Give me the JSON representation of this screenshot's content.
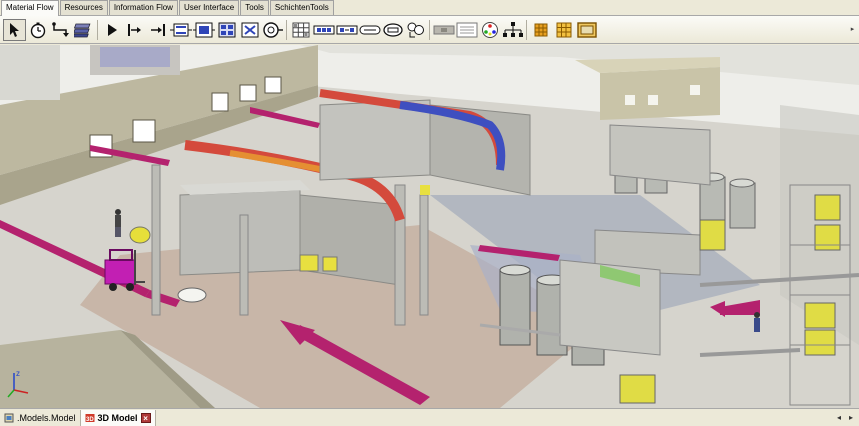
{
  "tabs": [
    {
      "label": "Material Flow",
      "active": true
    },
    {
      "label": "Resources",
      "active": false
    },
    {
      "label": "Information Flow",
      "active": false
    },
    {
      "label": "User Interface",
      "active": false
    },
    {
      "label": "Tools",
      "active": false
    },
    {
      "label": "SchichtenTools",
      "active": false
    }
  ],
  "toolbar": {
    "icons": [
      "pointer-icon",
      "event-controller-icon",
      "connector-icon",
      "cycle-icon",
      "source-icon",
      "drain-icon",
      "single-proc-icon",
      "parallel-proc-icon",
      "assembly-icon",
      "dismantle-icon",
      "line-icon",
      "turntable-icon",
      "store-icon",
      "buffer-icon",
      "sorter-icon",
      "track-icon",
      "transfer-station-icon",
      "flow-control-icon",
      "cross-icon",
      "exporter-icon",
      "shift-calendar-icon",
      "method-icon",
      "table-icon",
      "frame-icon"
    ],
    "more_glyph": "▸"
  },
  "bottom": {
    "tabs": [
      {
        "label": ".Models.Model",
        "active": false
      },
      {
        "label": "3D Model",
        "active": true
      }
    ],
    "nav_prev": "◂",
    "nav_next": "▸"
  },
  "axes": {
    "x": "x",
    "y": "y",
    "z": "z"
  },
  "colors": {
    "conveyor_pink": "#b4226e",
    "floor_grey": "#c9c9c3",
    "wall": "#b8b39c",
    "forklift": "#c21fb3",
    "machine": "#c8c8c4",
    "duct_red": "#d44a3c",
    "duct_blue": "#3e4fc0",
    "yellow": "#e0dc45"
  }
}
